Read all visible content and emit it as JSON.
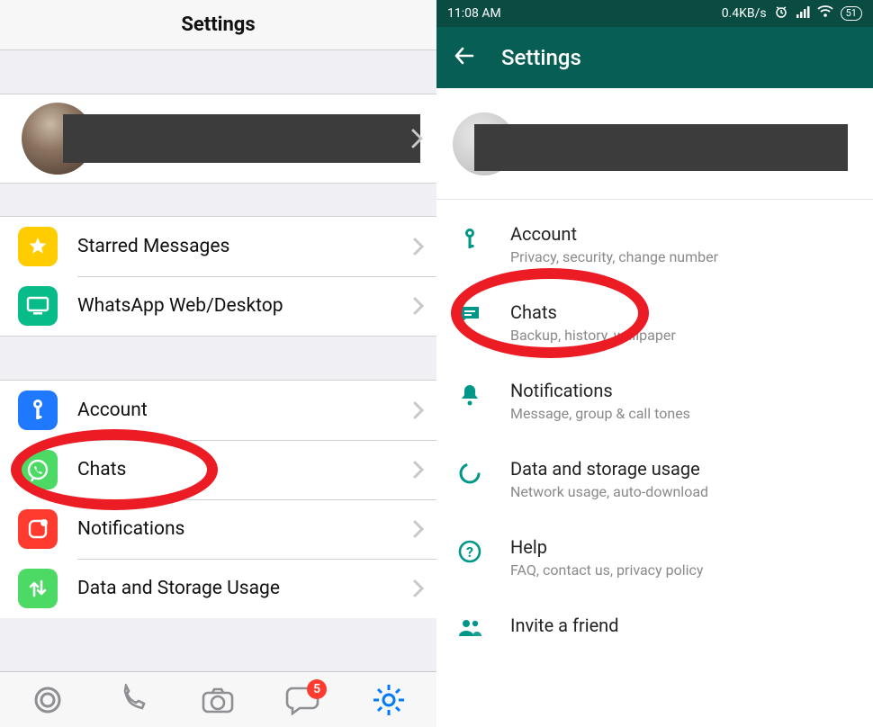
{
  "ios": {
    "header_title": "Settings",
    "sections": {
      "starred": "Starred Messages",
      "web": "WhatsApp Web/Desktop",
      "account": "Account",
      "chats": "Chats",
      "notifications": "Notifications",
      "data": "Data and Storage Usage"
    },
    "tab_badge": "5"
  },
  "android": {
    "status": {
      "time": "11:08 AM",
      "speed": "0.4KB/s",
      "battery": "51"
    },
    "appbar_title": "Settings",
    "items": {
      "account": {
        "title": "Account",
        "sub": "Privacy, security, change number"
      },
      "chats": {
        "title": "Chats",
        "sub": "Backup, history, wallpaper"
      },
      "notif": {
        "title": "Notifications",
        "sub": "Message, group & call tones"
      },
      "data": {
        "title": "Data and storage usage",
        "sub": "Network usage, auto-download"
      },
      "help": {
        "title": "Help",
        "sub": "FAQ, contact us, privacy policy"
      },
      "invite": {
        "title": "Invite a friend"
      }
    }
  }
}
